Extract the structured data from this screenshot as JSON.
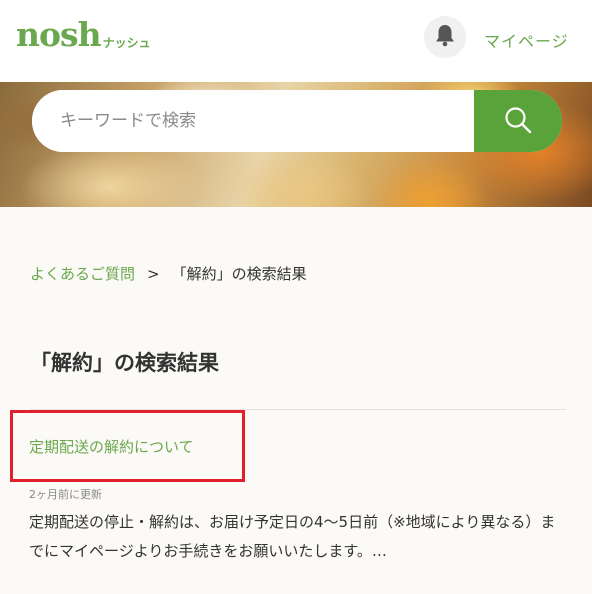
{
  "header": {
    "logo_main": "nosh",
    "logo_sub": "ナッシュ",
    "bell_icon": "bell-icon",
    "mypage_label": "マイページ"
  },
  "hero": {
    "search_placeholder": "キーワードで検索",
    "search_value": "",
    "search_icon": "search-icon"
  },
  "breadcrumb": {
    "link_label": "よくあるご質問",
    "separator": ">",
    "current_label": "「解約」の検索結果"
  },
  "results": {
    "title": "「解約」の検索結果",
    "items": [
      {
        "title": "定期配送の解約について",
        "updated": "2ヶ月前に更新",
        "snippet": "定期配送の停止・解約は、お届け予定日の4〜5日前（※地域により異なる）までにマイページよりお手続きをお願いいたします。…"
      }
    ]
  },
  "colors": {
    "brand_green": "#6aa84f",
    "search_button": "#5aa33a",
    "highlight_red": "#e0202a"
  }
}
